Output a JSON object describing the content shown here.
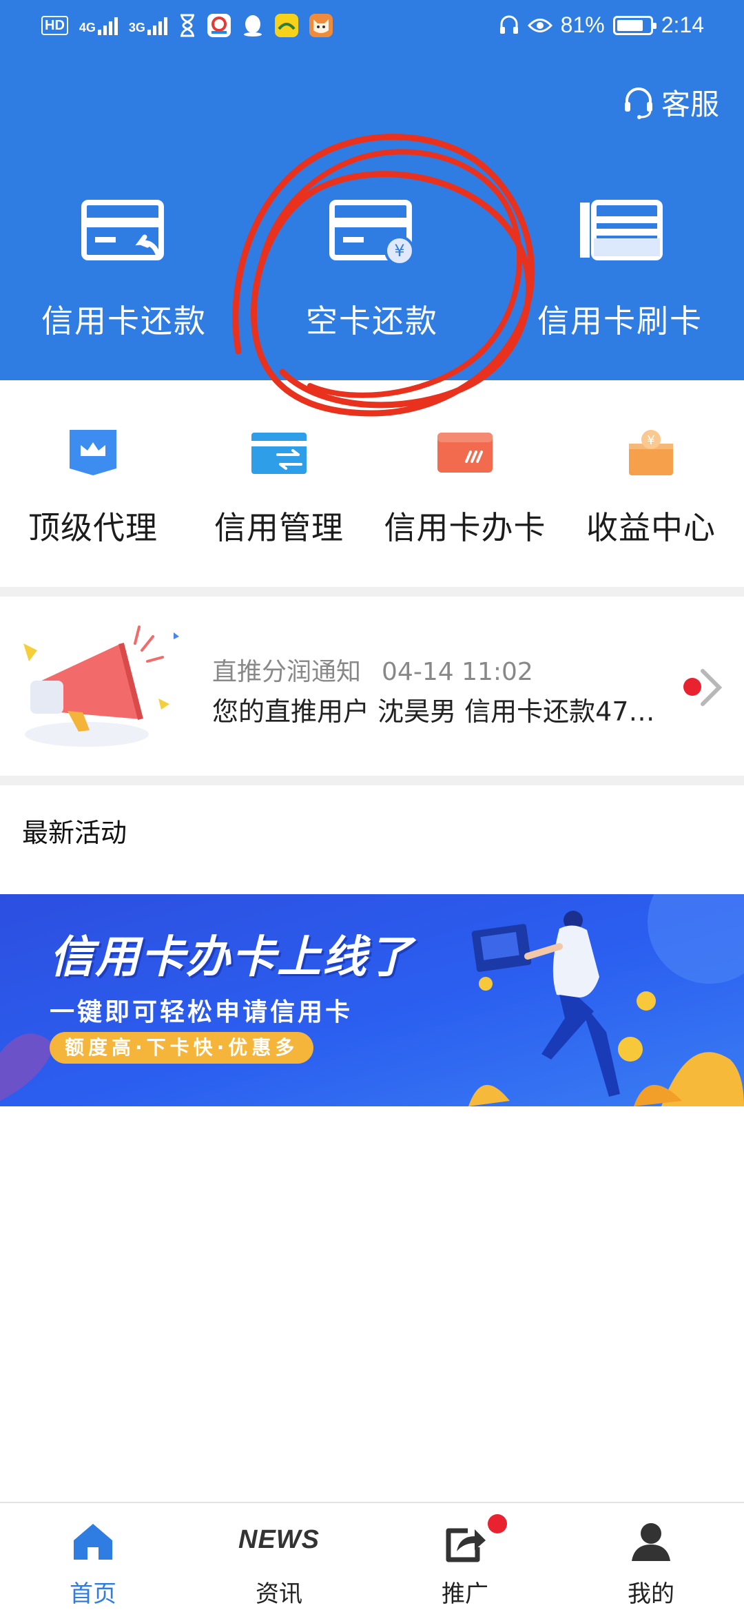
{
  "status_bar": {
    "hd_label": "HD",
    "net1": "4G",
    "net2": "3G",
    "battery_percent_text": "81%",
    "battery_level": 0.81,
    "time": "2:14"
  },
  "header": {
    "service_label": "客服",
    "actions": [
      {
        "label": "信用卡还款",
        "icon": "card-repay-icon"
      },
      {
        "label": "空卡还款",
        "icon": "card-yuan-icon"
      },
      {
        "label": "信用卡刷卡",
        "icon": "card-swipe-icon"
      }
    ]
  },
  "menu": {
    "items": [
      {
        "label": "顶级代理",
        "icon": "crown-icon",
        "color": "#3d8df0"
      },
      {
        "label": "信用管理",
        "icon": "transfer-card-icon",
        "color": "#2f9ee8"
      },
      {
        "label": "信用卡办卡",
        "icon": "apply-card-icon",
        "color": "#f26b4f"
      },
      {
        "label": "收益中心",
        "icon": "earnings-icon",
        "color": "#f7a04b"
      }
    ]
  },
  "notice": {
    "title": "直推分润通知",
    "time": "04-14 11:02",
    "text": "您的直推用户 沈昊男 信用卡还款471..."
  },
  "section": {
    "latest_title": "最新活动"
  },
  "banner": {
    "headline": "信用卡办卡上线了",
    "subtitle": "一键即可轻松申请信用卡",
    "pill": "额度高·下卡快·优惠多"
  },
  "tabbar": {
    "tabs": [
      {
        "label": "首页",
        "icon": "home-icon",
        "active": true
      },
      {
        "label": "资讯",
        "icon": "news-icon",
        "word": "NEWS"
      },
      {
        "label": "推广",
        "icon": "share-icon",
        "badge": true
      },
      {
        "label": "我的",
        "icon": "user-icon"
      }
    ]
  },
  "colors": {
    "header_blue": "#2f7de3",
    "annotation_red": "#e8321e",
    "badge_red": "#e8232f"
  }
}
